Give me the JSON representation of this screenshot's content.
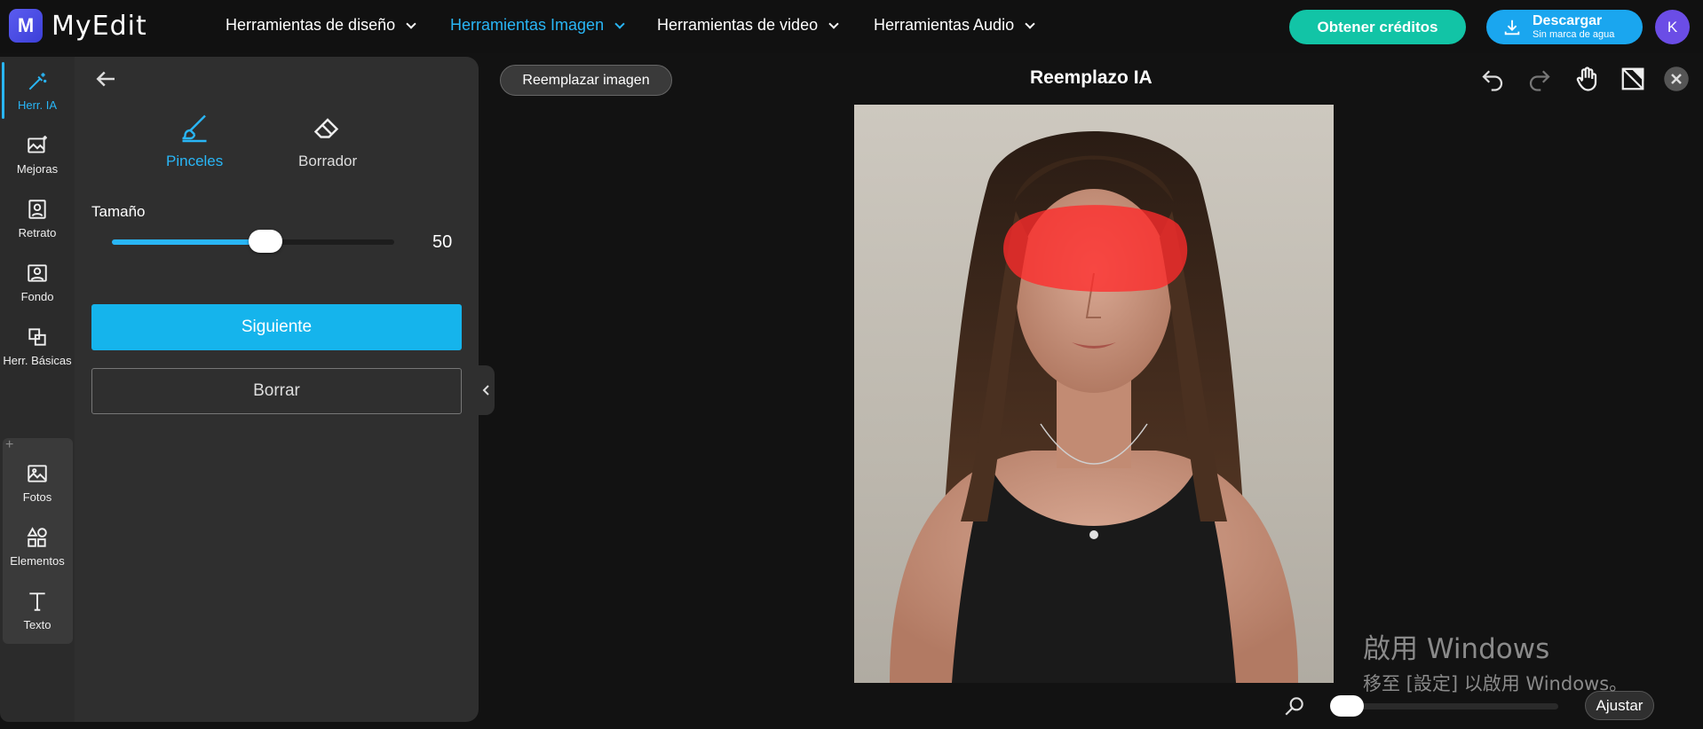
{
  "app": {
    "name": "MyEdit",
    "logo_letter": "M"
  },
  "nav": [
    {
      "label": "Herramientas de diseño",
      "active": false
    },
    {
      "label": "Herramientas Imagen",
      "active": true
    },
    {
      "label": "Herramientas de video",
      "active": false
    },
    {
      "label": "Herramientas Audio",
      "active": false
    }
  ],
  "header": {
    "credits_label": "Obtener créditos",
    "download_label": "Descargar",
    "download_sub": "Sin marca de agua",
    "avatar_initial": "K"
  },
  "rail": [
    {
      "label": "Herr. IA",
      "icon": "magic-wand-icon",
      "active": true
    },
    {
      "label": "Mejoras",
      "icon": "image-sparkle-icon",
      "active": false
    },
    {
      "label": "Retrato",
      "icon": "portrait-icon",
      "active": false
    },
    {
      "label": "Fondo",
      "icon": "background-icon",
      "active": false
    },
    {
      "label": "Herr. Básicas",
      "icon": "layers-icon",
      "active": false
    },
    {
      "label": "Fotos",
      "icon": "photo-icon",
      "active": false
    },
    {
      "label": "Elementos",
      "icon": "shapes-icon",
      "active": false
    },
    {
      "label": "Texto",
      "icon": "text-icon",
      "active": false
    }
  ],
  "panel": {
    "brush_label": "Pinceles",
    "eraser_label": "Borrador",
    "size_label": "Tamaño",
    "size_value": "50",
    "size_fraction": 0.5,
    "next_label": "Siguiente",
    "clear_label": "Borrar"
  },
  "canvas": {
    "replace_label": "Reemplazar imagen",
    "title": "Reemplazo IA",
    "fit_label": "Ajustar",
    "zoom_fraction": 0.0
  },
  "watermark": {
    "line1": "啟用 Windows",
    "line2": "移至 [設定] 以啟用 Windows。"
  },
  "colors": {
    "accent": "#29b6f6",
    "credits": "#12c4a6",
    "download": "#1aa6ef",
    "mask": "#ff2b2b"
  }
}
